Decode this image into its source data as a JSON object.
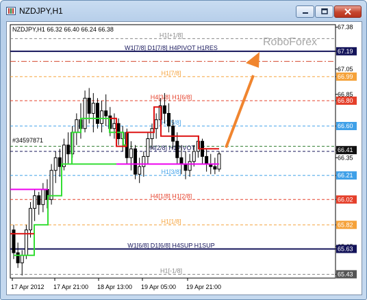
{
  "window": {
    "title": "NZDJPY,H1",
    "buttons": [
      "minimize",
      "maximize",
      "close"
    ]
  },
  "chart_header": {
    "symbol": "NZDJPY,H1",
    "ohlc": "66.32 66.40 66.24 66.38"
  },
  "watermark": "RoboForex",
  "chart_data": {
    "type": "candlestick",
    "symbol": "NZDJPY",
    "timeframe": "H1",
    "price_axis_ticks": [
      "67.38",
      "67.19",
      "67.05",
      "66.99",
      "66.85",
      "66.80",
      "66.60",
      "66.41",
      "66.35",
      "66.21",
      "66.02",
      "65.82",
      "65.65",
      "65.63",
      "65.43"
    ],
    "highlighted_price_labels": [
      {
        "price": "67.19",
        "color": "#14145a"
      },
      {
        "price": "66.99",
        "color": "#f5a23a"
      },
      {
        "price": "66.80",
        "color": "#e5402b"
      },
      {
        "price": "66.60",
        "color": "#3fa0e8"
      },
      {
        "price": "66.41",
        "color": "#111111"
      },
      {
        "price": "66.21",
        "color": "#3fa0e8"
      },
      {
        "price": "66.02",
        "color": "#e5402b"
      },
      {
        "price": "65.82",
        "color": "#f5a23a"
      },
      {
        "price": "65.63",
        "color": "#14145a"
      },
      {
        "price": "65.43",
        "color": "#555555"
      }
    ],
    "time_axis_labels": [
      "17 Apr 2012",
      "17 Apr 21:00",
      "18 Apr 13:00",
      "19 Apr 05:00",
      "19 Apr 21:00"
    ],
    "murrey_levels": [
      {
        "price": 67.29,
        "label": "H1[+1/8]",
        "color": "#888888",
        "style": "dash"
      },
      {
        "price": 67.19,
        "label": "W1[7/8] D1[7/8] H4PIVOT H1RES",
        "color": "#14145a",
        "style": "solid"
      },
      {
        "price": 67.11,
        "label": "",
        "color": "#d2452b",
        "style": "dashdot"
      },
      {
        "price": 66.99,
        "label": "H1[7/8]",
        "color": "#f5a23a",
        "style": "dash"
      },
      {
        "price": 66.8,
        "label": "H4[3/8] H1[6/8]",
        "color": "#e5402b",
        "style": "dash"
      },
      {
        "price": 66.6,
        "label": "H1[5/8]",
        "color": "#3fa0e8",
        "style": "dash"
      },
      {
        "price": 66.44,
        "label": "",
        "color": "#2a7a2a",
        "style": "dash"
      },
      {
        "price": 66.4,
        "label": "H4[2/8] H1PIVOT",
        "color": "#14145a",
        "style": "dash"
      },
      {
        "price": 66.21,
        "label": "H1[3/8]",
        "color": "#3fa0e8",
        "style": "dash"
      },
      {
        "price": 66.02,
        "label": "H4[1/8] H1[2/8]",
        "color": "#e5402b",
        "style": "dash"
      },
      {
        "price": 65.82,
        "label": "H1[1/8]",
        "color": "#f5a23a",
        "style": "dash"
      },
      {
        "price": 65.63,
        "label": "W1[6/8] D1[6/8] H4SUP H1SUP",
        "color": "#14145a",
        "style": "solid"
      },
      {
        "price": 65.43,
        "label": "H1[-1/8]",
        "color": "#888888",
        "style": "dash"
      }
    ],
    "annotations": [
      {
        "text": "#34597871",
        "price": 66.47
      }
    ],
    "ohlc_bars": [
      [
        65.78,
        65.82,
        65.55,
        65.6
      ],
      [
        65.6,
        65.68,
        65.48,
        65.52
      ],
      [
        65.52,
        65.62,
        65.42,
        65.58
      ],
      [
        65.58,
        65.82,
        65.55,
        65.78
      ],
      [
        65.78,
        66.0,
        65.72,
        65.95
      ],
      [
        65.95,
        66.1,
        65.85,
        66.05
      ],
      [
        66.05,
        66.08,
        65.9,
        65.98
      ],
      [
        65.98,
        66.15,
        65.92,
        66.1
      ],
      [
        66.1,
        66.18,
        65.95,
        66.02
      ],
      [
        66.02,
        66.3,
        65.98,
        66.25
      ],
      [
        66.25,
        66.4,
        66.15,
        66.35
      ],
      [
        66.35,
        66.42,
        66.2,
        66.28
      ],
      [
        66.28,
        66.5,
        66.25,
        66.45
      ],
      [
        66.45,
        66.55,
        66.3,
        66.38
      ],
      [
        66.38,
        66.6,
        66.35,
        66.55
      ],
      [
        66.55,
        66.7,
        66.45,
        66.65
      ],
      [
        66.65,
        66.78,
        66.5,
        66.58
      ],
      [
        66.58,
        66.88,
        66.55,
        66.82
      ],
      [
        66.82,
        66.9,
        66.62,
        66.7
      ],
      [
        66.7,
        66.86,
        66.55,
        66.78
      ],
      [
        66.78,
        66.82,
        66.58,
        66.62
      ],
      [
        66.62,
        66.8,
        66.55,
        66.72
      ],
      [
        66.72,
        66.85,
        66.6,
        66.68
      ],
      [
        66.68,
        66.75,
        66.52,
        66.58
      ],
      [
        66.58,
        66.7,
        66.5,
        66.62
      ],
      [
        66.62,
        66.66,
        66.45,
        66.5
      ],
      [
        66.5,
        66.6,
        66.4,
        66.55
      ],
      [
        66.55,
        66.58,
        66.3,
        66.35
      ],
      [
        66.35,
        66.48,
        66.25,
        66.42
      ],
      [
        66.42,
        66.45,
        66.18,
        66.22
      ],
      [
        66.22,
        66.35,
        66.15,
        66.28
      ],
      [
        66.28,
        66.4,
        66.2,
        66.36
      ],
      [
        66.36,
        66.55,
        66.3,
        66.5
      ],
      [
        66.5,
        66.62,
        66.42,
        66.58
      ],
      [
        66.58,
        66.7,
        66.5,
        66.65
      ],
      [
        66.65,
        66.82,
        66.6,
        66.76
      ],
      [
        66.76,
        66.86,
        66.62,
        66.7
      ],
      [
        66.7,
        66.78,
        66.55,
        66.6
      ],
      [
        66.6,
        66.65,
        66.42,
        66.48
      ],
      [
        66.48,
        66.55,
        66.3,
        66.35
      ],
      [
        66.35,
        66.45,
        66.22,
        66.3
      ],
      [
        66.3,
        66.4,
        66.18,
        66.25
      ],
      [
        66.25,
        66.38,
        66.2,
        66.32
      ],
      [
        66.32,
        66.45,
        66.28,
        66.4
      ],
      [
        66.4,
        66.52,
        66.35,
        66.48
      ],
      [
        66.48,
        66.5,
        66.3,
        66.36
      ],
      [
        66.36,
        66.42,
        66.24,
        66.3
      ],
      [
        66.3,
        66.38,
        66.22,
        66.28
      ],
      [
        66.28,
        66.35,
        66.22,
        66.26
      ],
      [
        66.26,
        66.4,
        66.24,
        66.38
      ]
    ]
  }
}
